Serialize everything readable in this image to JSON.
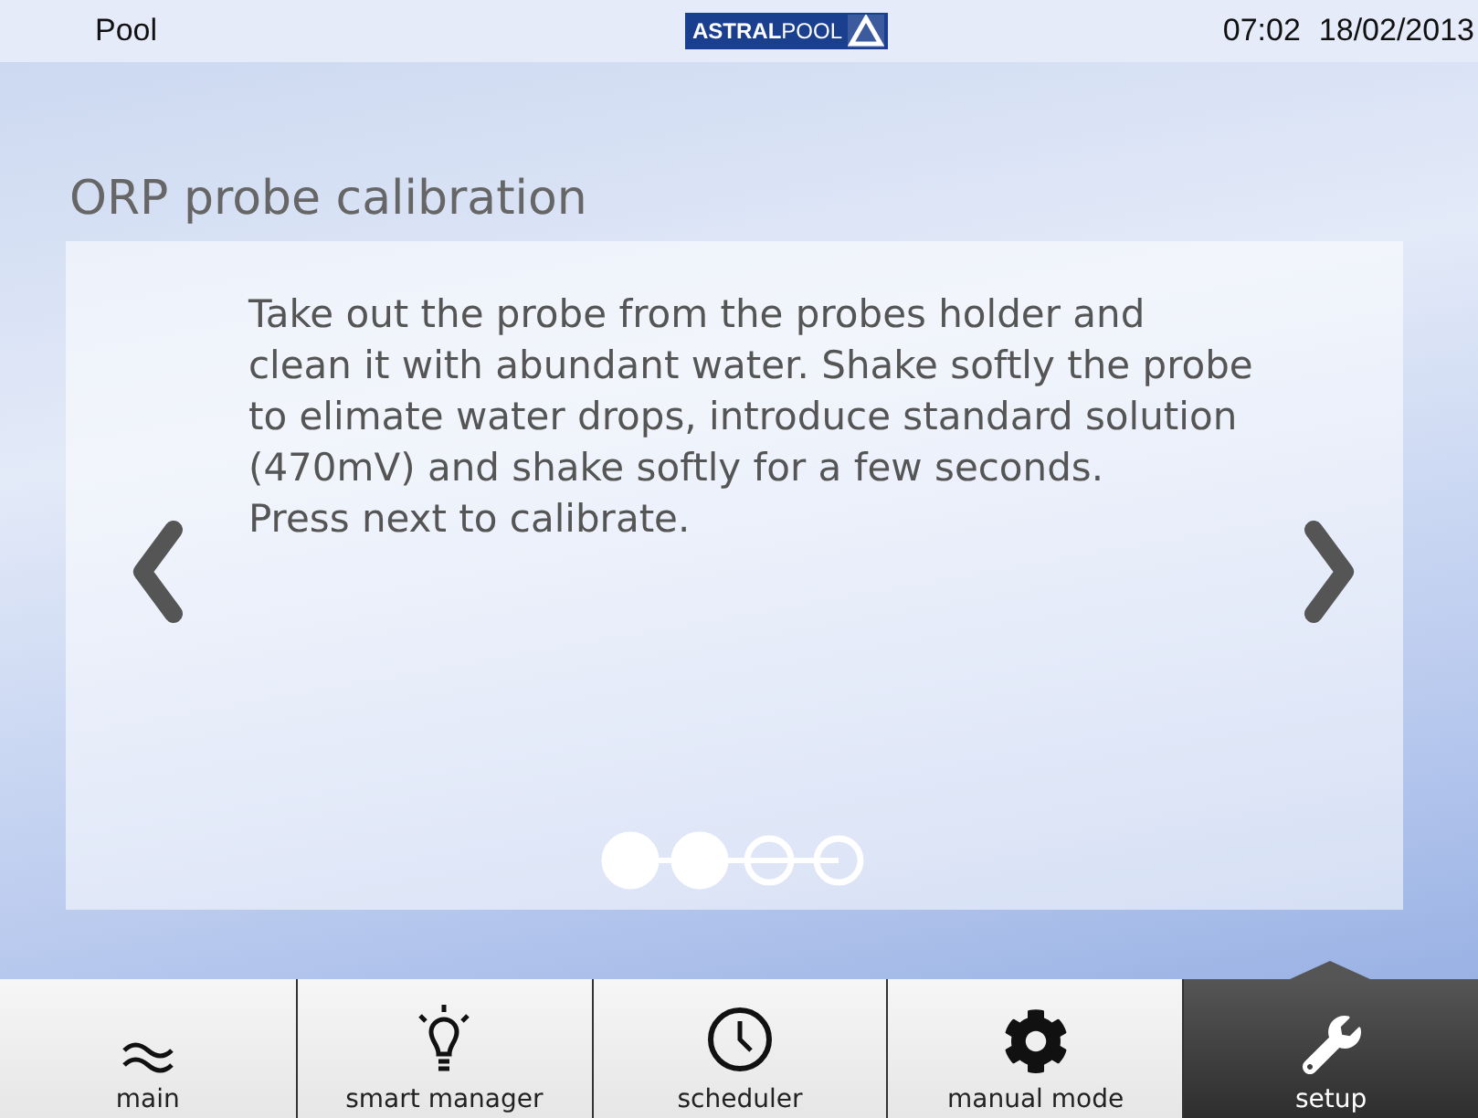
{
  "header": {
    "title": "Pool",
    "logo": {
      "bold": "ASTRAL",
      "light": "POOL"
    },
    "time": "07:02",
    "date": "18/02/2013"
  },
  "page_title": "ORP probe calibration",
  "instructions": [
    "Take out the probe from the probes holder and clean it with abundant water. Shake softly the probe to elimate water drops, introduce standard solution (470mV) and shake softly for a few seconds.",
    "Press next to calibrate."
  ],
  "steps": [
    {
      "done": true
    },
    {
      "done": true
    },
    {
      "done": false
    },
    {
      "done": false
    }
  ],
  "nav": [
    {
      "label": "main",
      "kind": "waves",
      "selected": false
    },
    {
      "label": "smart manager",
      "kind": "bulb",
      "selected": false
    },
    {
      "label": "scheduler",
      "kind": "clock",
      "selected": false
    },
    {
      "label": "manual mode",
      "kind": "gear",
      "selected": false
    },
    {
      "label": "setup",
      "kind": "wrench",
      "selected": true
    }
  ]
}
